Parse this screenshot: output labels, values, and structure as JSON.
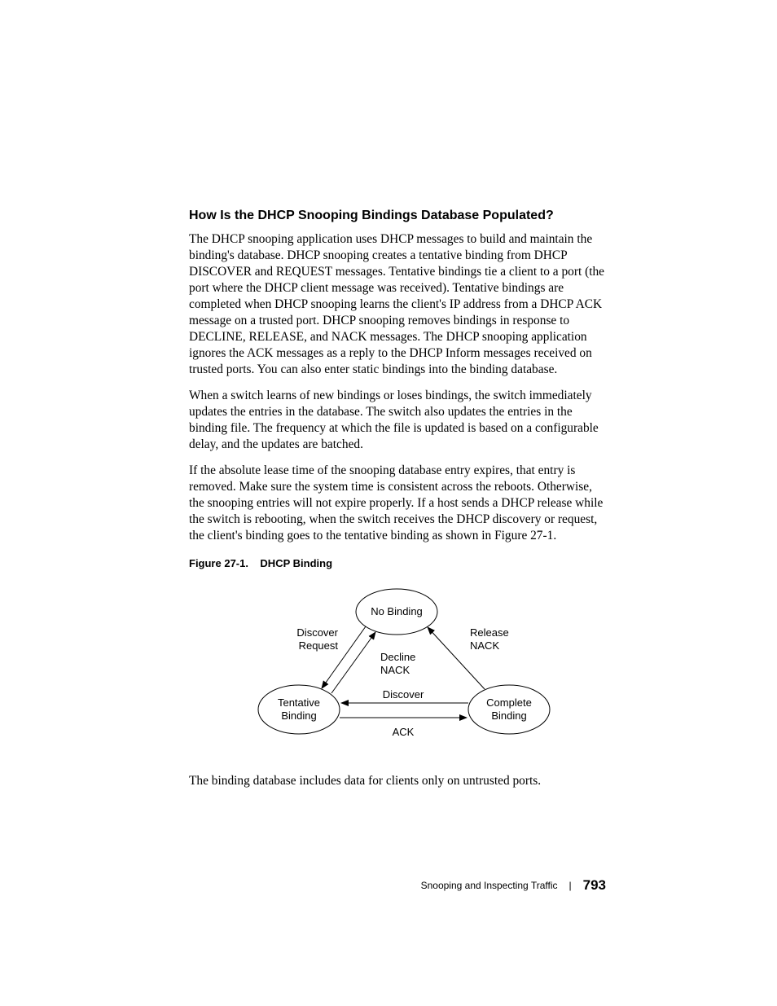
{
  "heading": "How Is the DHCP Snooping Bindings Database Populated?",
  "p1": "The DHCP snooping application uses DHCP messages to build and maintain the binding's database. DHCP snooping creates a tentative binding from DHCP DISCOVER and REQUEST messages. Tentative bindings tie a client to a port (the port where the DHCP client message was received). Tentative bindings are completed when DHCP snooping learns the client's IP address from a DHCP ACK message on a trusted port. DHCP snooping removes bindings in response to DECLINE, RELEASE, and NACK messages. The DHCP snooping application ignores the ACK messages as a reply to the DHCP Inform messages received on trusted ports. You can also enter static bindings into the binding database.",
  "p2": "When a switch learns of new bindings or loses bindings, the switch immediately updates the entries in the database. The switch also updates the entries in the binding file. The frequency at which the file is updated is based on a configurable delay, and the updates are batched.",
  "p3": "If the absolute lease time of the snooping database entry expires, that entry is removed. Make sure the system time is consistent across the reboots. Otherwise, the snooping entries will not expire properly. If a host sends a DHCP release while the switch is rebooting, when the switch receives the DHCP discovery or request, the client's binding goes to the tentative binding as shown in Figure 27-1.",
  "fig_caption_num": "Figure 27-1.",
  "fig_caption_title": "DHCP Binding",
  "p4": "The binding database includes data for clients only on untrusted ports.",
  "diagram": {
    "node_top": "No Binding",
    "node_left_l1": "Tentative",
    "node_left_l2": "Binding",
    "node_right_l1": "Complete",
    "node_right_l2": "Binding",
    "label_left_top_l1": "Discover",
    "label_left_top_l2": "Request",
    "label_mid_top_l1": "Decline",
    "label_mid_top_l2": "NACK",
    "label_right_top_l1": "Release",
    "label_right_top_l2": "NACK",
    "label_mid_bottom_upper": "Discover",
    "label_mid_bottom_lower": "ACK"
  },
  "footer": {
    "section": "Snooping and Inspecting Traffic",
    "page": "793"
  }
}
